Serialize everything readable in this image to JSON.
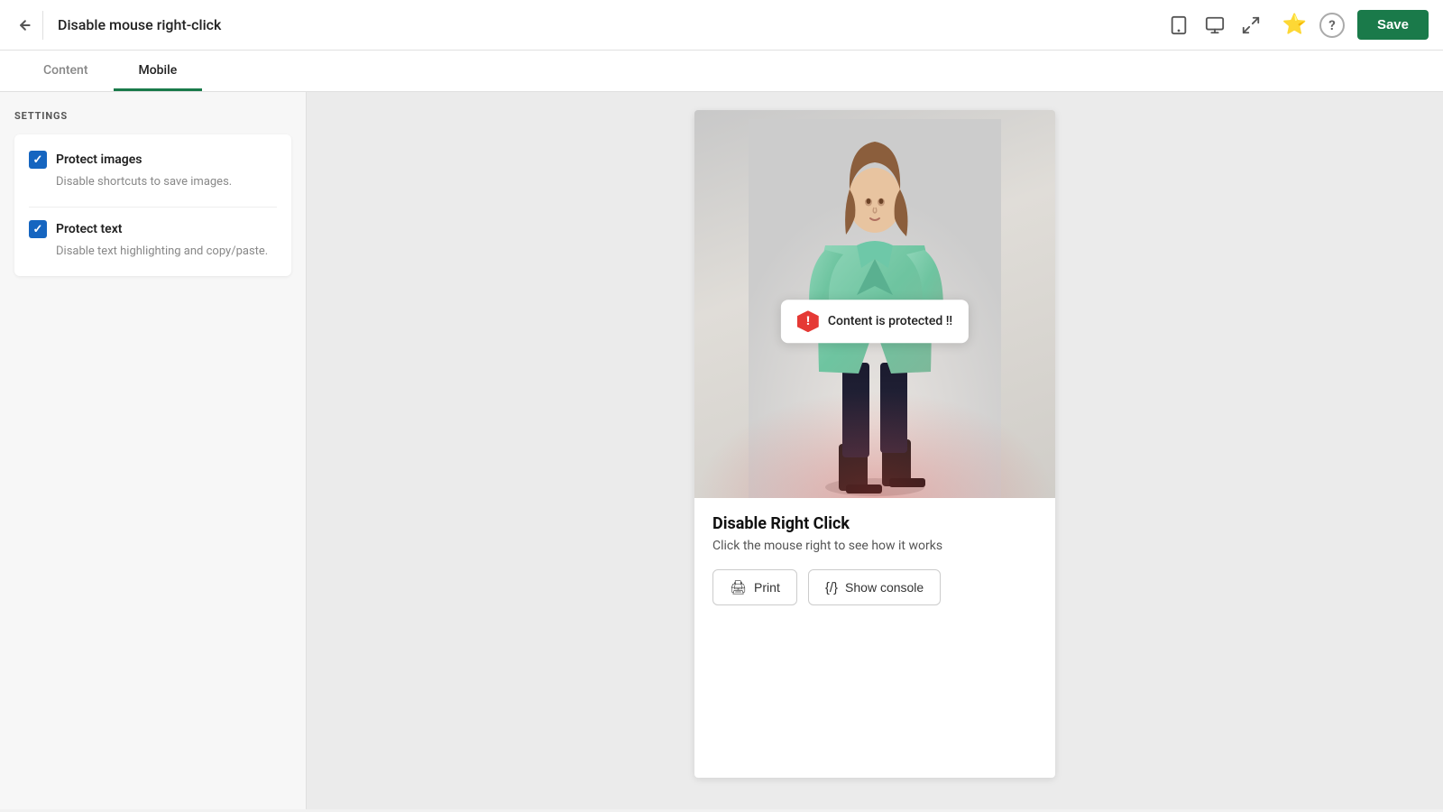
{
  "topbar": {
    "back_icon": "←",
    "title": "Disable mouse right-click",
    "device_icons": [
      "tablet",
      "monitor",
      "expand"
    ],
    "star_icon": "⭐",
    "help_icon": "?",
    "save_label": "Save"
  },
  "tabs": [
    {
      "label": "Content",
      "active": false
    },
    {
      "label": "Mobile",
      "active": true
    }
  ],
  "sidebar": {
    "settings_label": "SETTINGS",
    "items": [
      {
        "name": "protect_images",
        "label": "Protect images",
        "description": "Disable shortcuts to save images.",
        "checked": true
      },
      {
        "name": "protect_text",
        "label": "Protect text",
        "description": "Disable text highlighting and copy/paste.",
        "checked": true
      }
    ]
  },
  "preview": {
    "tooltip_text": "Content is protected !!",
    "title": "Disable Right Click",
    "subtitle": "Click the mouse right to see how it works",
    "btn_print": "Print",
    "btn_console": "Show console"
  }
}
